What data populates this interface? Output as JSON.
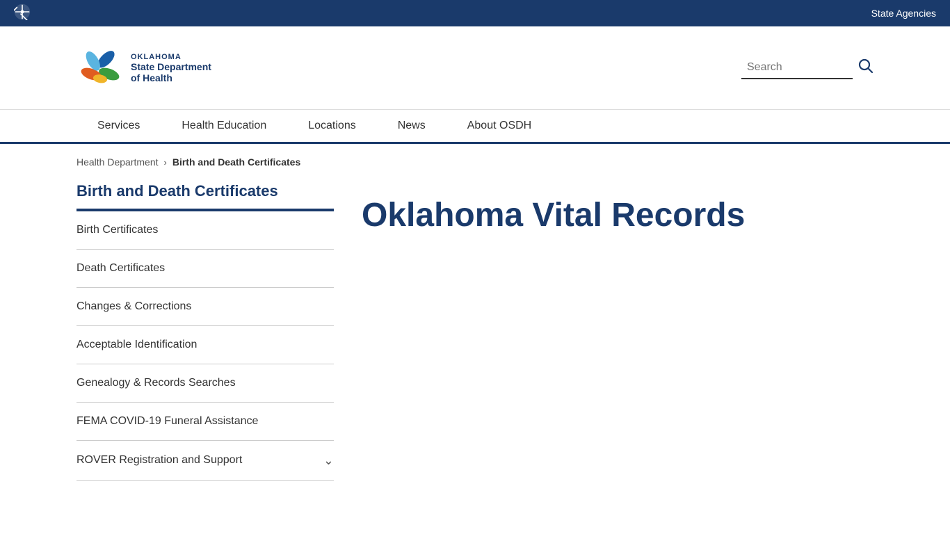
{
  "topbar": {
    "state_agencies": "State Agencies"
  },
  "header": {
    "logo_line1": "OKLAHOMA",
    "logo_line2": "State Department",
    "logo_line3": "of Health",
    "search_placeholder": "Search",
    "search_label": "Search"
  },
  "nav": {
    "items": [
      {
        "label": "Services",
        "id": "services"
      },
      {
        "label": "Health Education",
        "id": "health-education"
      },
      {
        "label": "Locations",
        "id": "locations"
      },
      {
        "label": "News",
        "id": "news"
      },
      {
        "label": "About OSDH",
        "id": "about-osdh"
      }
    ]
  },
  "breadcrumb": {
    "parent": "Health Department",
    "current": "Birth and Death Certificates"
  },
  "sidebar": {
    "title": "Birth and Death Certificates",
    "items": [
      {
        "label": "Birth Certificates",
        "has_chevron": false
      },
      {
        "label": "Death Certificates",
        "has_chevron": false
      },
      {
        "label": "Changes & Corrections",
        "has_chevron": false
      },
      {
        "label": "Acceptable Identification",
        "has_chevron": false
      },
      {
        "label": "Genealogy & Records Searches",
        "has_chevron": false
      },
      {
        "label": "FEMA COVID-19 Funeral Assistance",
        "has_chevron": false
      },
      {
        "label": "ROVER Registration and Support",
        "has_chevron": true
      }
    ]
  },
  "main": {
    "page_title": "Oklahoma Vital Records"
  }
}
